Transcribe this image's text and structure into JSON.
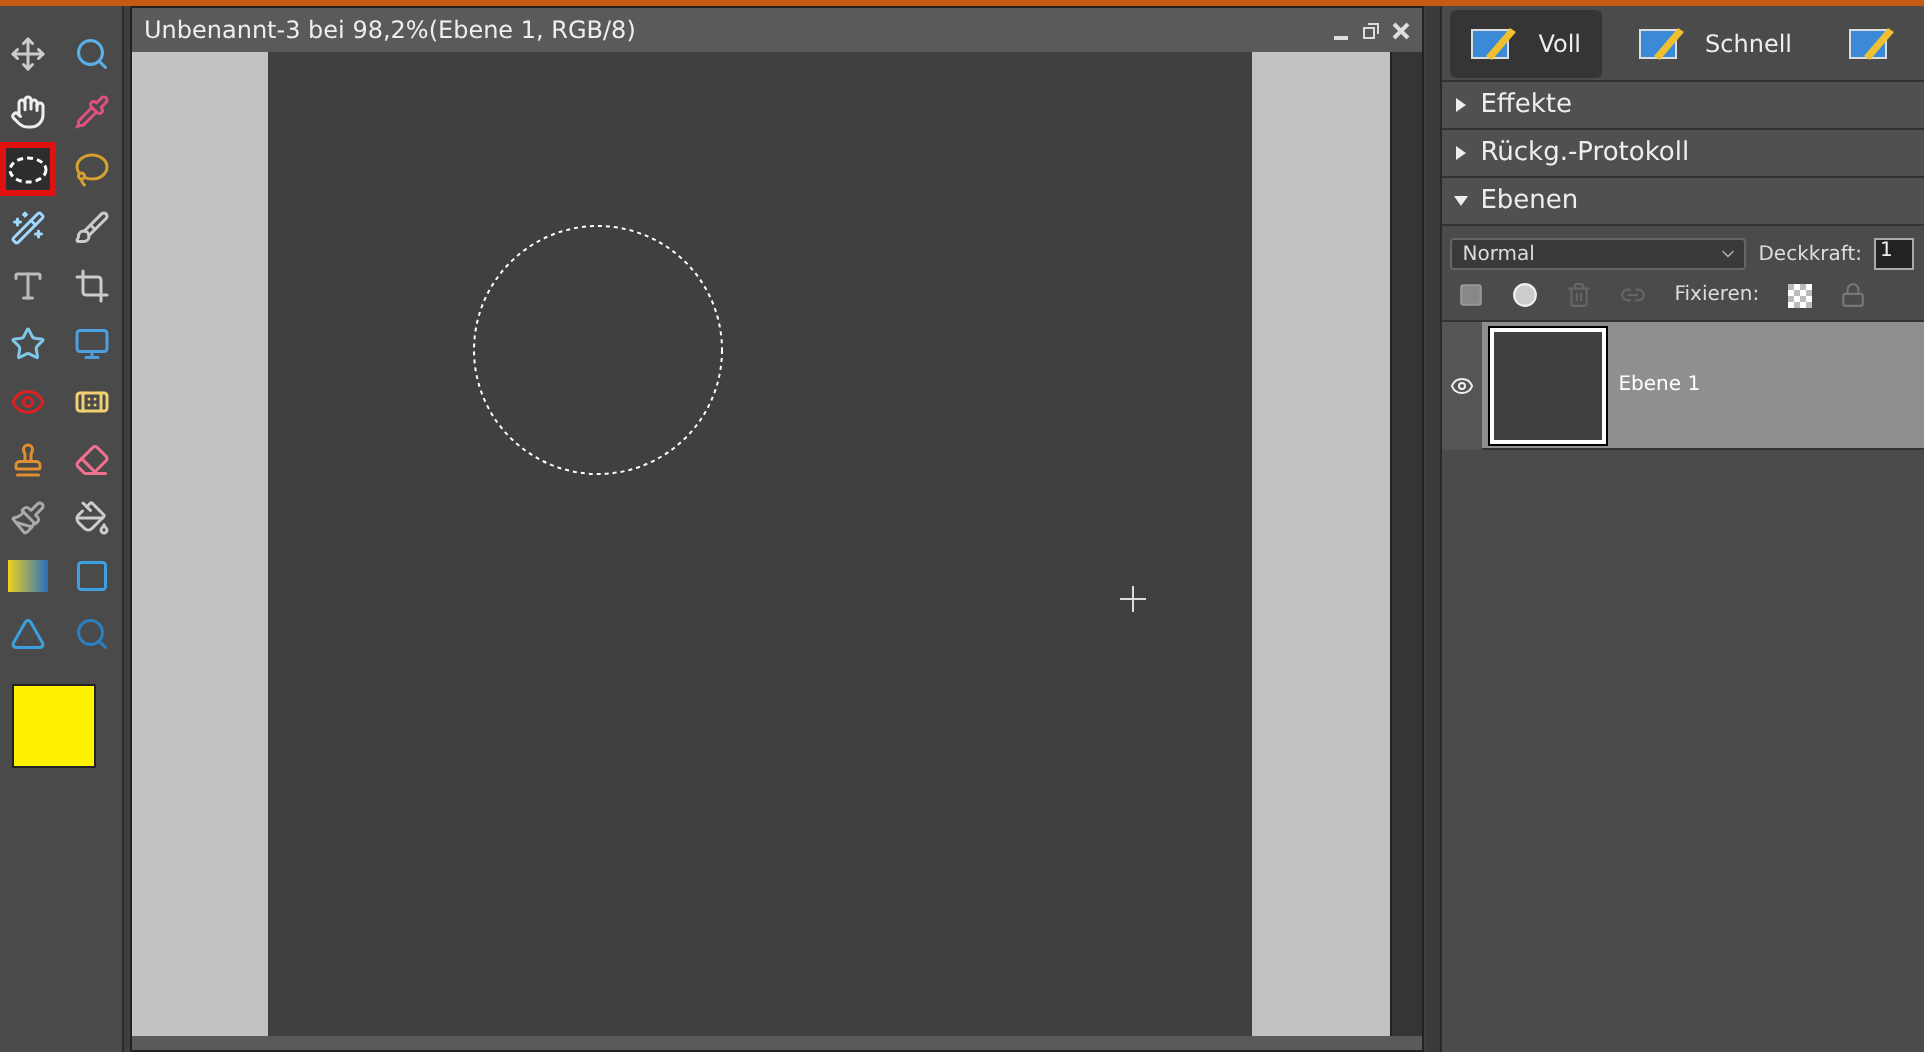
{
  "document": {
    "title": "Unbenannt-3 bei 98,2%(Ebene 1, RGB/8)"
  },
  "tools": [
    {
      "kind": "move",
      "selected": false
    },
    {
      "kind": "zoom",
      "selected": false
    },
    {
      "kind": "hand",
      "selected": false
    },
    {
      "kind": "eyedropper",
      "selected": false
    },
    {
      "kind": "marquee",
      "selected": true
    },
    {
      "kind": "lasso",
      "selected": false
    },
    {
      "kind": "wand",
      "selected": false
    },
    {
      "kind": "selectbrush",
      "selected": false
    },
    {
      "kind": "type",
      "selected": false
    },
    {
      "kind": "crop",
      "selected": false
    },
    {
      "kind": "star",
      "selected": false
    },
    {
      "kind": "recompose",
      "selected": false
    },
    {
      "kind": "redeye",
      "selected": false
    },
    {
      "kind": "heal",
      "selected": false
    },
    {
      "kind": "stamp",
      "selected": false
    },
    {
      "kind": "eraser",
      "selected": false
    },
    {
      "kind": "brush",
      "selected": false
    },
    {
      "kind": "bucket",
      "selected": false
    },
    {
      "kind": "gradient",
      "selected": false
    },
    {
      "kind": "rectangle",
      "selected": false
    },
    {
      "kind": "sharpen",
      "selected": false
    },
    {
      "kind": "smudge",
      "selected": false
    }
  ],
  "foreground_color": {
    "color": "#fff200"
  },
  "modes": [
    {
      "label": "Voll",
      "selected": true
    },
    {
      "label": "Schnell",
      "selected": false
    },
    {
      "selected": false
    }
  ],
  "panels": [
    {
      "title": "Effekte",
      "expanded": false
    },
    {
      "title": "Rückg.-Protokoll",
      "expanded": false
    },
    {
      "title": "Ebenen",
      "expanded": true
    }
  ],
  "layers_panel": {
    "blend_mode": "Normal",
    "opacity_label": "Deckkraft:",
    "opacity_value": "1",
    "lock_label": "Fixieren:",
    "layers": [
      {
        "name": "Ebene 1",
        "visible": true,
        "selected": true
      }
    ]
  }
}
